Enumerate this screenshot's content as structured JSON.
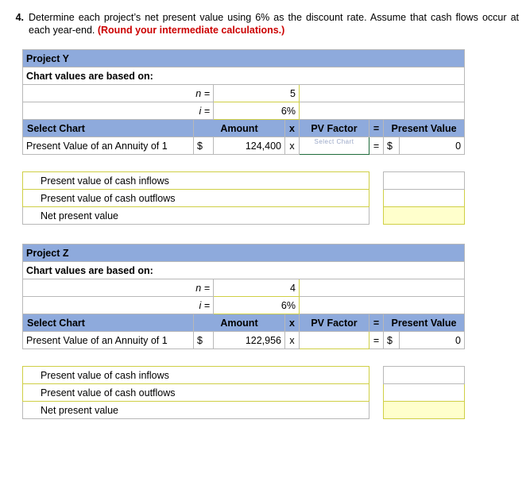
{
  "question": {
    "number": "4.",
    "text_part1": "Determine each project’s net present value using 6% as the discount rate. Assume that cash flows occur at each year-end. ",
    "text_highlight": "(Round your intermediate calculations.)"
  },
  "projects": [
    {
      "title": "Project Y",
      "subtitle": "Chart values are based on:",
      "n_label": "n =",
      "n_value": "5",
      "i_label": "i =",
      "i_value": "6%",
      "headers": {
        "select_chart": "Select Chart",
        "amount": "Amount",
        "times": "x",
        "pv_factor": "PV Factor",
        "equals": "=",
        "present_value": "Present Value"
      },
      "row": {
        "chart_name": "Present Value of an Annuity of 1",
        "currency": "$",
        "amount": "124,400",
        "times": "x",
        "pv_factor": "",
        "pv_factor_watermark": "Select Chart",
        "equals": "=",
        "pv_currency": "$",
        "present_value": "0"
      },
      "summary": [
        {
          "label": "Present value of cash inflows",
          "value": "",
          "highlight": false
        },
        {
          "label": "Present value of cash outflows",
          "value": "",
          "highlight": false
        },
        {
          "label": "Net present value",
          "value": "",
          "highlight": true
        }
      ]
    },
    {
      "title": "Project Z",
      "subtitle": "Chart values are based on:",
      "n_label": "n =",
      "n_value": "4",
      "i_label": "i =",
      "i_value": "6%",
      "headers": {
        "select_chart": "Select Chart",
        "amount": "Amount",
        "times": "x",
        "pv_factor": "PV Factor",
        "equals": "=",
        "present_value": "Present Value"
      },
      "row": {
        "chart_name": "Present Value of an Annuity of 1",
        "currency": "$",
        "amount": "122,956",
        "times": "x",
        "pv_factor": "",
        "pv_factor_watermark": "",
        "equals": "=",
        "pv_currency": "$",
        "present_value": "0"
      },
      "summary": [
        {
          "label": "Present value of cash inflows",
          "value": "",
          "highlight": false
        },
        {
          "label": "Present value of cash outflows",
          "value": "",
          "highlight": false
        },
        {
          "label": "Net present value",
          "value": "",
          "highlight": true
        }
      ]
    }
  ],
  "colors": {
    "header_blue": "#8eaadc",
    "input_border": "#cfcf45",
    "input_fill": "#ffffcc",
    "focus_border": "#1f6b3b",
    "red_text": "#cc0000"
  }
}
